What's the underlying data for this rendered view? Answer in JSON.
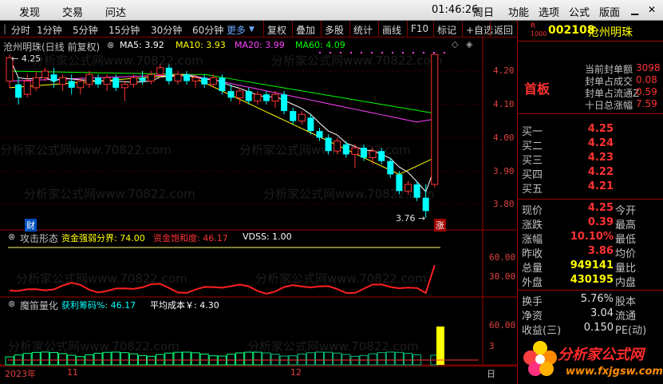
{
  "menu": {
    "items": [
      "发现",
      "交易",
      "问达"
    ],
    "clock": "01:46:26",
    "weekday": "周日",
    "right_items": [
      "功能",
      "选项",
      "公式",
      "版面"
    ]
  },
  "toolbar": {
    "periods": [
      "分时",
      "1分钟",
      "5分钟",
      "15分钟",
      "30分钟",
      "60分钟",
      "更多"
    ],
    "buttons": [
      "复权",
      "叠加",
      "多股",
      "统计",
      "画线",
      "F10",
      "标记",
      "+自选",
      "返回"
    ]
  },
  "main_chart": {
    "title": "沧州明珠(日线 前复权)",
    "ma": [
      {
        "label": "MA5: 3.92",
        "color": "#ffffff"
      },
      {
        "label": "MA10: 3.93",
        "color": "#ffff00"
      },
      {
        "label": "MA20: 3.99",
        "color": "#ff40ff"
      },
      {
        "label": "MA60: 4.09",
        "color": "#00ff00"
      }
    ],
    "price_ticks": [
      "4.20",
      "4.10",
      "4.00",
      "3.90",
      "3.80"
    ],
    "high_label": "4.25",
    "low_label": "3.76",
    "cai_label": "财",
    "zhang_label": "涨"
  },
  "indicator1": {
    "name": "攻击形态",
    "items": [
      {
        "label": "资金强弱分界: 74.00",
        "color": "#ffff00"
      },
      {
        "label": "资金饱和度: 46.17",
        "color": "#ff3232"
      },
      {
        "label": "VDSS: 1.00",
        "color": "#ffffff"
      }
    ],
    "ticks": [
      "60.00",
      "30.00"
    ]
  },
  "indicator2": {
    "name": "魔笛量化",
    "items": [
      {
        "label": "获利筹码%: 46.17",
        "color": "#00ffff"
      },
      {
        "label": "平均成本￥: 4.30",
        "color": "#ffffff"
      }
    ],
    "ticks": [
      "60.00",
      "3"
    ]
  },
  "date_axis": {
    "labels": [
      "2023年",
      "11",
      "12"
    ],
    "unit": "日"
  },
  "stock": {
    "code_prefix": "R",
    "code_sub": "1000",
    "code": "002108",
    "name": "沧州明珠",
    "status": "首板",
    "summary": [
      {
        "label": "当前封单额",
        "value": "3098"
      },
      {
        "label": "封单占成交",
        "value": "0.08"
      },
      {
        "label": "封单占流通Z",
        "value": "0.59"
      },
      {
        "label": "十日总涨幅",
        "value": "7.59"
      }
    ],
    "order_book": [
      {
        "label": "买一",
        "value": "4.25"
      },
      {
        "label": "买二",
        "value": "4.24"
      },
      {
        "label": "买三",
        "value": "4.23"
      },
      {
        "label": "买四",
        "value": "4.22"
      },
      {
        "label": "买五",
        "value": "4.21"
      }
    ],
    "quote": [
      {
        "l": "现价",
        "v": "4.25",
        "r": "今开"
      },
      {
        "l": "涨跌",
        "v": "0.39",
        "r": "最高"
      },
      {
        "l": "涨幅",
        "v": "10.10%",
        "r": "最低"
      },
      {
        "l": "昨收",
        "v": "3.86",
        "r": "均价"
      },
      {
        "l": "总量",
        "v": "949141",
        "r": "量比"
      },
      {
        "l": "外盘",
        "v": "430195",
        "r": "内盘"
      }
    ],
    "stats": [
      {
        "l": "换手",
        "v": "5.76%",
        "r": "股本"
      },
      {
        "l": "净资",
        "v": "3.04",
        "r": "流通"
      },
      {
        "l": "收益(三)",
        "v": "0.150",
        "r": "PE(动)"
      }
    ]
  },
  "watermark": {
    "text": "分析家公式网www.70822.com",
    "logo": "分析家公式网",
    "url": "www.fxjgsw.com"
  },
  "colors": {
    "up": "#ff3232",
    "down": "#00ffff",
    "ma5": "#ffffff",
    "ma10": "#ffff00",
    "ma20": "#ff40ff",
    "ma60": "#00ff00"
  }
}
